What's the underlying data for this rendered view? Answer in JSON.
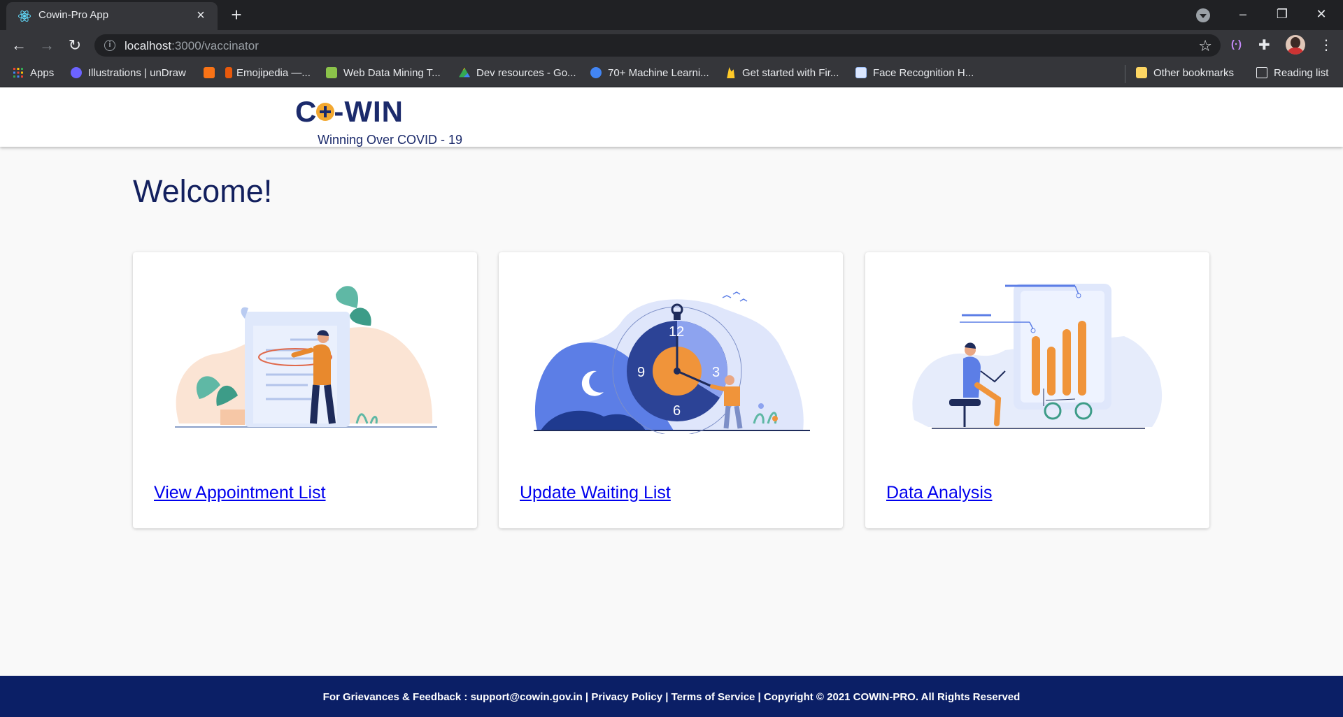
{
  "browser": {
    "tab_title": "Cowin-Pro App",
    "url_host": "localhost",
    "url_path": ":3000/vaccinator",
    "bookmarks": [
      {
        "label": "Apps",
        "color": "#ea4335"
      },
      {
        "label": "Illustrations | unDraw",
        "color": "#6c63ff"
      },
      {
        "label": "",
        "color": "#f97316"
      },
      {
        "label": "Emojipedia —...",
        "color": "#e8590c"
      },
      {
        "label": "Web Data Mining T...",
        "color": "#8bc34a"
      },
      {
        "label": "Dev resources - Go...",
        "color": "#34a853"
      },
      {
        "label": "70+ Machine Learni...",
        "color": "#4285f4"
      },
      {
        "label": "Get started with Fir...",
        "color": "#ffca28"
      },
      {
        "label": "Face Recognition H...",
        "color": "#a0c4ff"
      }
    ],
    "other_bookmarks": "Other bookmarks",
    "reading_list": "Reading list"
  },
  "header": {
    "logo_c": "C",
    "logo_win": "-WIN",
    "tagline": "Winning Over COVID - 19"
  },
  "main": {
    "welcome": "Welcome!",
    "cards": [
      {
        "link": "View Appointment List",
        "art": "appointment-illustration"
      },
      {
        "link": "Update Waiting List",
        "art": "clock-illustration"
      },
      {
        "link": "Data Analysis",
        "art": "data-analysis-illustration"
      }
    ]
  },
  "footer": {
    "prefix": "For Grievances & Feedback : ",
    "email": "support@cowin.gov.in",
    "sep1": " | ",
    "privacy": "Privacy Policy",
    "sep2": " | ",
    "terms": "Terms of Service",
    "sep3": " | ",
    "copyright": "Copyright © 2021 COWIN-PRO. All Rights Reserved"
  },
  "colors": {
    "brand_navy": "#0b1f66",
    "accent_orange": "#f0943a",
    "link_blue": "#0000ee"
  }
}
